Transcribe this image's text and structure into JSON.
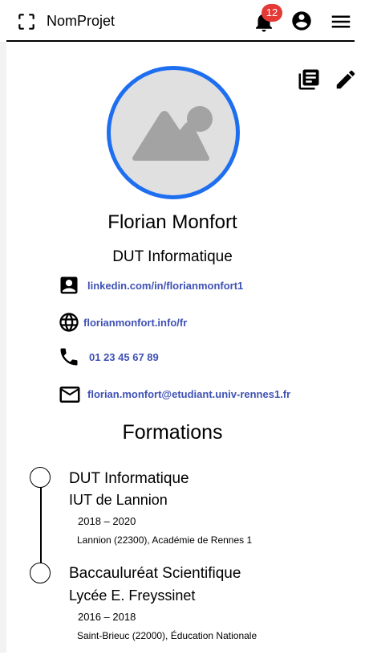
{
  "header": {
    "app_title": "NomProjet",
    "notification_count": "12",
    "icons": [
      "crop-free-icon",
      "bell-icon",
      "account-circle-icon",
      "menu-icon"
    ],
    "badge_color": "#e53935"
  },
  "actions": {
    "icons": [
      "library-books-icon",
      "edit-icon"
    ]
  },
  "profile": {
    "name": "Florian Monfort",
    "subtitle": "DUT Informatique",
    "avatar_border_color": "#1e6ff0"
  },
  "contacts": [
    {
      "icon": "contact-card-icon",
      "text": "linkedin.com/in/florianmonfort1"
    },
    {
      "icon": "globe-icon",
      "text": "florianmonfort.info/fr"
    },
    {
      "icon": "phone-icon",
      "text": "01 23 45 67 89"
    },
    {
      "icon": "mail-icon",
      "text": "florian.monfort@etudiant.univ-rennes1.fr"
    }
  ],
  "link_color": "#3f51b5",
  "formations": {
    "title": "Formations",
    "items": [
      {
        "degree": "DUT Informatique",
        "school": "IUT de Lannion",
        "years": "2018 – 2020",
        "location": "Lannion (22300), Académie de Rennes 1"
      },
      {
        "degree": "Baccauluréat Scientifique",
        "school": "Lycée E. Freyssinet",
        "years": "2016 – 2018",
        "location": "Saint-Brieuc (22000), Éducation Nationale"
      }
    ]
  }
}
